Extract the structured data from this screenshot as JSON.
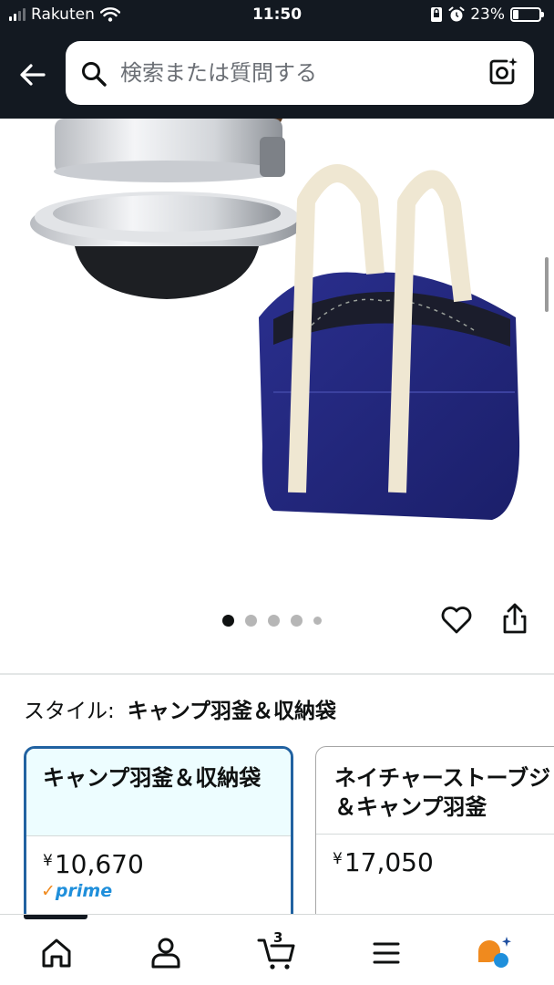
{
  "status_bar": {
    "carrier": "Rakuten",
    "time": "11:50",
    "battery": "23%",
    "battery_level": 0.23
  },
  "search": {
    "placeholder": "検索または質問する",
    "value": ""
  },
  "gallery": {
    "image_count": 5,
    "active_index": 0
  },
  "style_selector": {
    "label": "スタイル:",
    "selected_value": "キャンプ羽釜＆収納袋",
    "options": [
      {
        "title": "キャンプ羽釜＆収納袋",
        "currency": "¥",
        "price": "10,670",
        "prime_check": "✓",
        "prime_label": "prime"
      },
      {
        "title": "ネイチャーストーブジ＆キャンプ羽釜",
        "currency": "¥",
        "price": "17,050"
      }
    ]
  },
  "bottom_nav": {
    "items": [
      "home-icon",
      "profile-icon",
      "cart-icon",
      "menu-icon",
      "ai-assistant-icon"
    ],
    "cart_count": "3"
  },
  "colors": {
    "header_bg": "#131921",
    "selected_border": "#2162a1",
    "selected_fill": "#edfdff",
    "prime_blue": "#1f8fdb",
    "prime_orange": "#f08a1e"
  }
}
